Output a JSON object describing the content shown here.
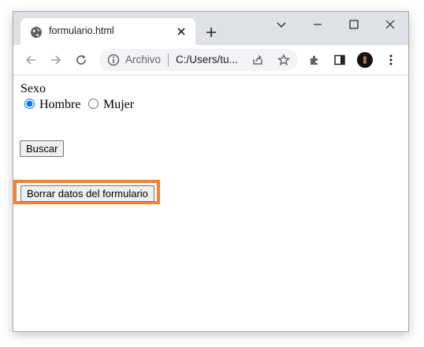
{
  "browser": {
    "tab": {
      "title": "formulario.html"
    },
    "address": {
      "scheme": "Archivo",
      "url": "C:/Users/tu..."
    }
  },
  "form": {
    "sexo_label": "Sexo",
    "options": [
      {
        "label": "Hombre",
        "checked": true
      },
      {
        "label": "Mujer",
        "checked": false
      }
    ],
    "search_button": "Buscar",
    "reset_button": "Borrar datos del formulario"
  },
  "colors": {
    "highlight": "#ff7f27",
    "titlebar": "#dee1e6",
    "omnibox": "#f1f3f4"
  }
}
